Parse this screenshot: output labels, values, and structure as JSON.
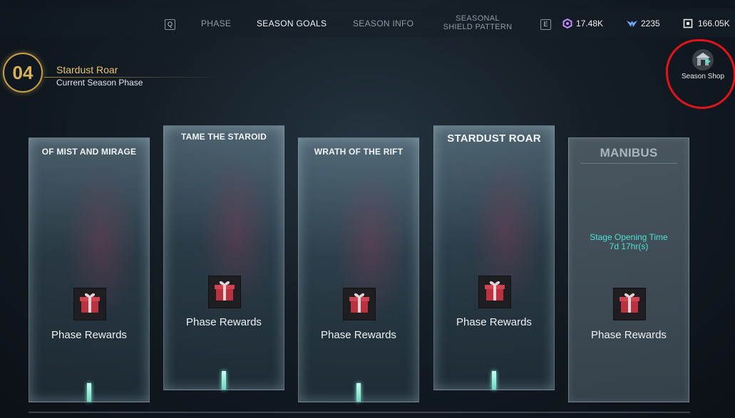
{
  "nav": {
    "key_left": "Q",
    "key_right": "E",
    "tabs": [
      {
        "label": "PHASE"
      },
      {
        "label": "SEASON GOALS",
        "active": true
      },
      {
        "label": "SEASON INFO"
      },
      {
        "label_line1": "SEASONAL",
        "label_line2": "SHIELD PATTERN"
      }
    ]
  },
  "currencies": [
    {
      "icon": "hexagon-currency-icon",
      "value": "17.48K",
      "color": "#c48bff"
    },
    {
      "icon": "wings-currency-icon",
      "value": "2235",
      "color": "#6fa8ff"
    },
    {
      "icon": "box-currency-icon",
      "value": "166.05K",
      "color": "#e6e6e6"
    }
  ],
  "phase": {
    "number": "04",
    "name": "Stardust Roar",
    "subtitle": "Current Season Phase"
  },
  "shop": {
    "label": "Season Shop",
    "icon": "shop-icon"
  },
  "cards": [
    {
      "title": "OF MIST AND MIRAGE",
      "reward_label": "Phase Rewards"
    },
    {
      "title": "TAME THE STAROID",
      "reward_label": "Phase Rewards"
    },
    {
      "title": "WRATH OF THE RIFT",
      "reward_label": "Phase Rewards"
    },
    {
      "title": "STARDUST ROAR",
      "reward_label": "Phase Rewards"
    },
    {
      "title": "MANIBUS",
      "reward_label": "Phase Rewards",
      "locked": true,
      "open_time_label": "Stage Opening Time",
      "open_time_value": "7d 17hr(s)"
    }
  ],
  "colors": {
    "accent_gold": "#d9b15a",
    "open_time": "#4fe0d4",
    "annotation_circle": "#e0141b"
  }
}
